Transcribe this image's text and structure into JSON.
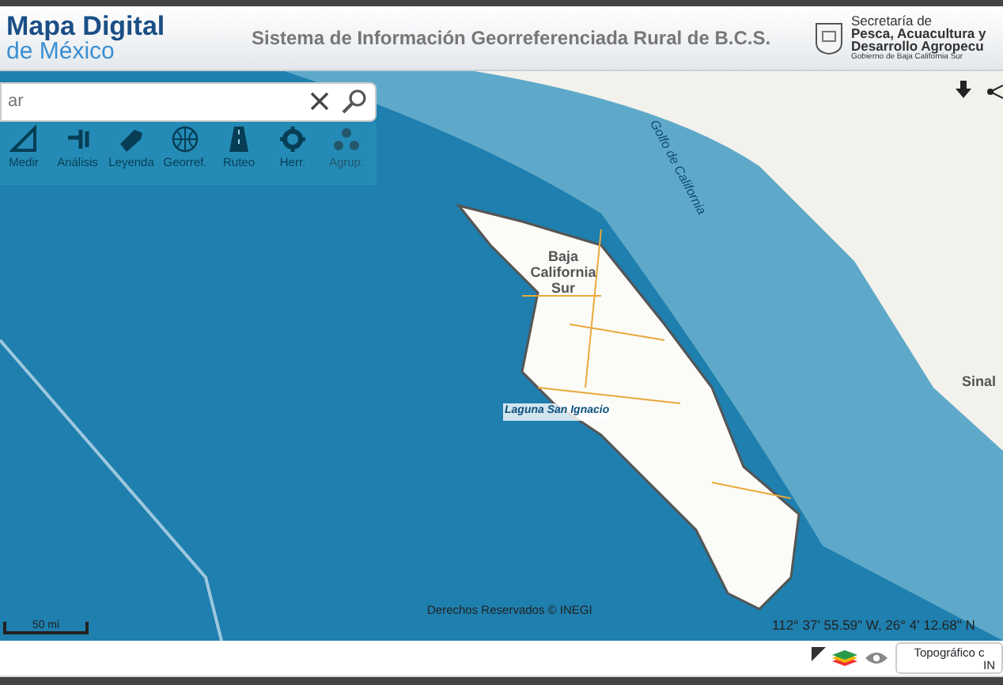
{
  "header": {
    "logo_line_1": "Mapa Digital",
    "logo_line_2": "de México",
    "title": "Sistema de Información Georreferenciada Rural de B.C.S.",
    "agency_line_1": "Secretaría de",
    "agency_line_2": "Pesca, Acuacultura y",
    "agency_line_3": "Desarrollo Agropecu",
    "agency_line_4": "Gobierno de Baja California Sur"
  },
  "search": {
    "placeholder": "ar"
  },
  "toolbar": [
    {
      "label": "Medir",
      "kind": "ruler",
      "disabled": false
    },
    {
      "label": "Análisis",
      "kind": "tool",
      "disabled": false
    },
    {
      "label": "Leyenda",
      "kind": "tag",
      "disabled": false
    },
    {
      "label": "Georref.",
      "kind": "globe",
      "disabled": false
    },
    {
      "label": "Ruteo",
      "kind": "road",
      "disabled": false
    },
    {
      "label": "Herr.",
      "kind": "gear",
      "disabled": false
    },
    {
      "label": "Agrup.",
      "kind": "dots",
      "disabled": true
    }
  ],
  "map": {
    "labels": [
      {
        "text": "Golfo de California",
        "kind": "sea"
      },
      {
        "text": "Baja California Sur",
        "kind": "state"
      },
      {
        "text": "Laguna San Ignacio",
        "kind": "lagoon"
      },
      {
        "text": "Sinal",
        "kind": "region"
      }
    ],
    "scale": "50 mi",
    "copyright": "Derechos Reservados © INEGI",
    "coordinates": "112° 37' 55.59\" W, 26° 4' 12.68\" N"
  },
  "basemap": {
    "line_1": "Topográfico c",
    "line_2": "IN"
  }
}
